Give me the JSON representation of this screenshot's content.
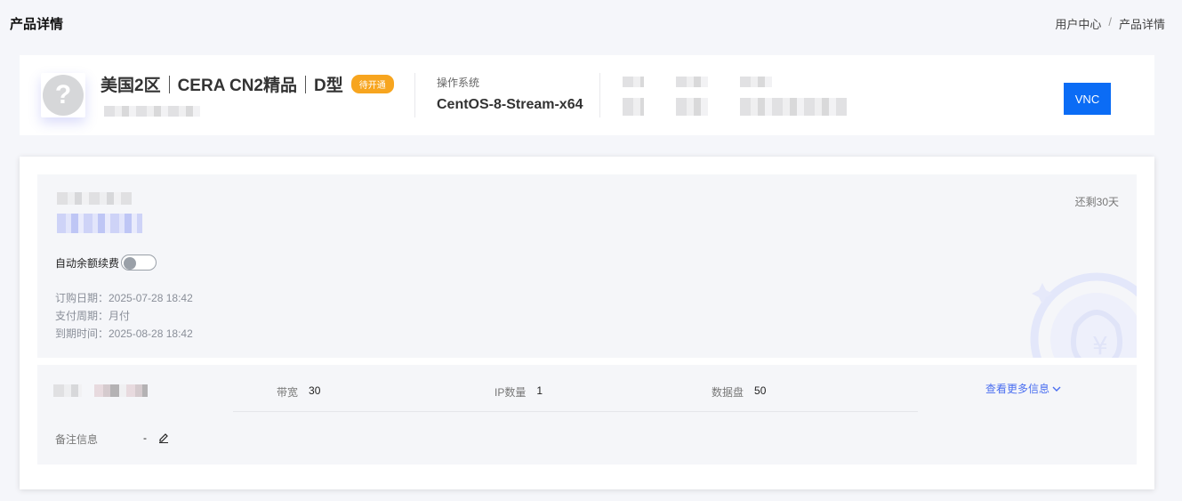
{
  "page": {
    "title": "产品详情",
    "breadcrumb": [
      "用户中心",
      "/",
      "产品详情"
    ]
  },
  "product": {
    "logo_icon": "question-mark-icon",
    "region": "美国2区",
    "line": "CERA CN2精品",
    "type": "D型",
    "status_badge": "待开通",
    "badge_color": "#f7a51f",
    "os_label": "操作系统",
    "os_value": "CentOS-8-Stream-x64",
    "vnc_label": "VNC",
    "accent_color": "#0b6cf5"
  },
  "billing": {
    "remaining": "还剩30天",
    "auto_renew_label": "自动余额续费",
    "auto_renew_enabled": false,
    "order_date": "订购日期：2025-07-28 18:42",
    "pay_cycle": "支付周期：月付",
    "expire_time": "到期时间：2025-08-28 18:42"
  },
  "specs": {
    "bandwidth_label": "带宽",
    "bandwidth_value": "30",
    "ip_label": "IP数量",
    "ip_value": "1",
    "disk_label": "数据盘",
    "disk_value": "50",
    "more_link": "查看更多信息",
    "remark_label": "备注信息",
    "remark_value": "-",
    "link_color": "#4a6ef0"
  }
}
